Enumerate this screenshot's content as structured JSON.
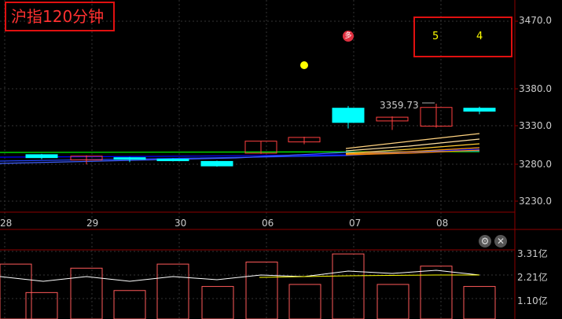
{
  "title": "沪指120分钟",
  "signal_counts": [
    "5",
    "4"
  ],
  "badge_text": "多",
  "last_price_label": "3359.73",
  "price_axis": [
    "3470.0",
    "3380.0",
    "3330.0",
    "3280.0",
    "3230.0"
  ],
  "dates": [
    "28",
    "29",
    "30",
    "06",
    "07",
    "08"
  ],
  "volume_axis": [
    "3.31亿",
    "2.21亿",
    "1.10亿"
  ],
  "icons": {
    "settings": "gear-icon",
    "close": "close-icon"
  },
  "colors": {
    "up": "#ff4040",
    "down": "#00ffff",
    "accent": "#ff3030",
    "signal": "#ffff00"
  },
  "chart_data": {
    "type": "candlestick",
    "price_range": [
      3220,
      3480
    ],
    "candles": [
      {
        "o": 3292,
        "c": 3288,
        "h": 3293,
        "l": 3286,
        "dir": "down"
      },
      {
        "o": 3285,
        "c": 3290,
        "h": 3291,
        "l": 3279,
        "dir": "up"
      },
      {
        "o": 3288,
        "c": 3287,
        "h": 3289,
        "l": 3282,
        "dir": "down"
      },
      {
        "o": 3286,
        "c": 3285,
        "h": 3287,
        "l": 3283,
        "dir": "down"
      },
      {
        "o": 3283,
        "c": 3277,
        "h": 3284,
        "l": 3276,
        "dir": "down"
      },
      {
        "o": 3294,
        "c": 3310,
        "h": 3310,
        "l": 3293,
        "dir": "up"
      },
      {
        "o": 3309,
        "c": 3315,
        "h": 3316,
        "l": 3306,
        "dir": "up"
      },
      {
        "o": 3354,
        "c": 3335,
        "h": 3357,
        "l": 3327,
        "dir": "down"
      },
      {
        "o": 3337,
        "c": 3342,
        "h": 3343,
        "l": 3325,
        "dir": "up"
      },
      {
        "o": 3330,
        "c": 3355,
        "h": 3360,
        "l": 3328,
        "dir": "up"
      },
      {
        "o": 3354,
        "c": 3350,
        "h": 3356,
        "l": 3346,
        "dir": "down"
      }
    ],
    "volumes": [
      2.7,
      1.3,
      2.5,
      1.4,
      2.7,
      1.6,
      2.8,
      1.7,
      3.2,
      1.7,
      2.6,
      1.6
    ],
    "volume_range": [
      0,
      3.4
    ]
  }
}
